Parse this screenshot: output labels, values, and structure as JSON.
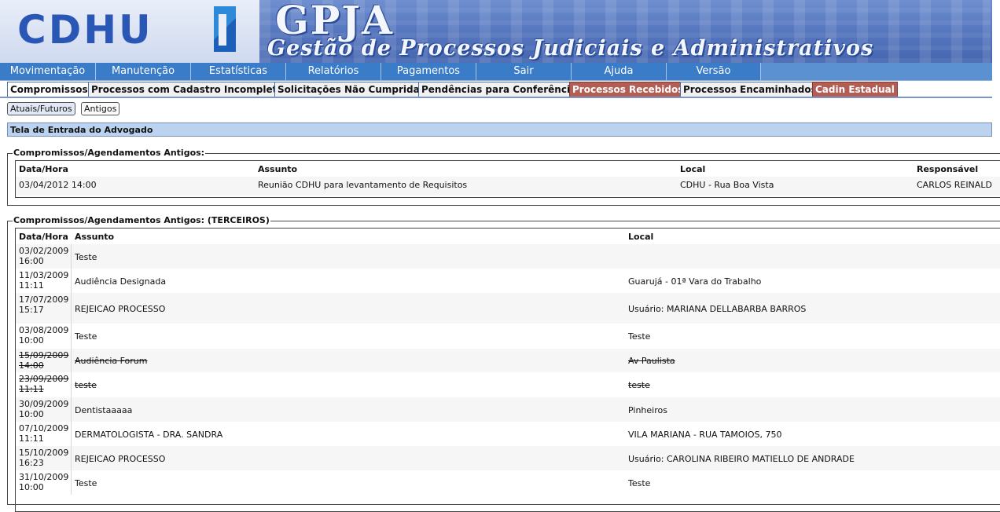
{
  "banner": {
    "logo_text": "CDHU",
    "app_name": "GPJA",
    "app_subtitle": "Gestão de Processos Judiciais e Administrativos"
  },
  "main_menu": [
    "Movimentação",
    "Manutenção",
    "Estatísticas",
    "Relatórios",
    "Pagamentos",
    "Sair",
    "Ajuda",
    "Versão"
  ],
  "tabs": [
    {
      "label": "Compromissos",
      "state": "active"
    },
    {
      "label": "Processos com Cadastro Incompleto",
      "state": "normal"
    },
    {
      "label": "Solicitações Não Cumpridas",
      "state": "normal"
    },
    {
      "label": "Pendências para Conferência",
      "state": "normal"
    },
    {
      "label": "Processos Recebidos",
      "state": "alert"
    },
    {
      "label": "Processos Encaminhados",
      "state": "normal"
    },
    {
      "label": "Cadin Estadual",
      "state": "alert"
    }
  ],
  "sub_buttons": [
    "Atuais/Futuros",
    "Antigos"
  ],
  "page_title": "Tela de Entrada do Advogado",
  "old_section": {
    "legend": "Compromissos/Agendamentos Antigos:",
    "headers": [
      "Data/Hora",
      "Assunto",
      "Local",
      "Responsável"
    ],
    "rows": [
      {
        "datetime": "03/04/2012 14:00",
        "assunto": "Reunião CDHU para levantamento de Requisitos",
        "local": "CDHU - Rua Boa Vista",
        "responsavel": "CARLOS REINALD"
      }
    ]
  },
  "third_section": {
    "legend": "Compromissos/Agendamentos Antigos: (TERCEIROS)",
    "headers": [
      "Data/Hora",
      "Assunto",
      "Local"
    ],
    "rows": [
      {
        "date": "03/02/2009",
        "time": "16:00",
        "assunto": "Teste",
        "local": "",
        "cancelled": false
      },
      {
        "date": "11/03/2009",
        "time": "11:11",
        "assunto": "Audiência Designada",
        "local": "Guarujá - 01ª Vara do Trabalho",
        "cancelled": false
      },
      {
        "date": "17/07/2009",
        "time": "15:17",
        "assunto": "REJEICAO PROCESSO",
        "local": "Usuário: MARIANA DELLABARBA BARROS",
        "cancelled": false
      },
      {
        "date": "03/08/2009",
        "time": "10:00",
        "assunto": "Teste",
        "local": "Teste",
        "cancelled": false
      },
      {
        "date": "15/09/2009",
        "time": "14:00",
        "assunto": "Audiência Forum",
        "local": "Av Paulista",
        "cancelled": true
      },
      {
        "date": "23/09/2009",
        "time": "11:11",
        "assunto": "teste",
        "local": "teste",
        "cancelled": true
      },
      {
        "date": "30/09/2009",
        "time": "10:00",
        "assunto": "Dentistaaaaa",
        "local": "Pinheiros",
        "cancelled": false
      },
      {
        "date": "07/10/2009",
        "time": "11:11",
        "assunto": "DERMATOLOGISTA - DRA. SANDRA",
        "local": "VILA MARIANA - RUA TAMOIOS, 750",
        "cancelled": false
      },
      {
        "date": "15/10/2009",
        "time": "16:23",
        "assunto": "REJEICAO PROCESSO",
        "local": "Usuário: CAROLINA RIBEIRO MATIELLO DE ANDRADE",
        "cancelled": false
      },
      {
        "date": "31/10/2009",
        "time": "10:00",
        "assunto": "Teste",
        "local": "Teste",
        "cancelled": false
      }
    ]
  },
  "colors": {
    "menu_bg": "#3a7cc7",
    "tab_alert": "#b35e55",
    "title_bar": "#bcd3ef"
  }
}
